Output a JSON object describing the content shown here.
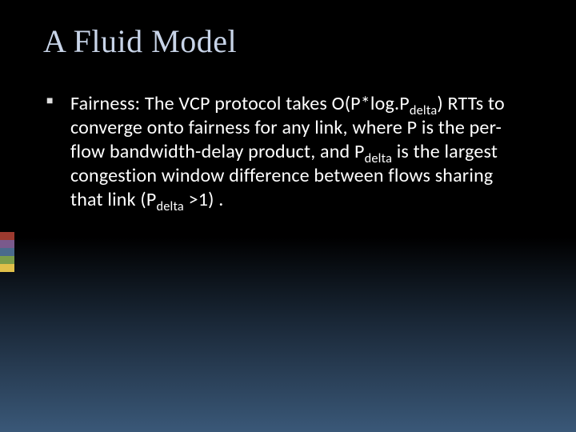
{
  "title": "A Fluid Model",
  "bullet": {
    "segments": [
      {
        "t": "Fairness: The VCP protocol takes O(P*log.P"
      },
      {
        "t": "delta",
        "sub": true
      },
      {
        "t": ") RTTs to converge onto fairness for any link, where P is the per-flow bandwidth-delay product, and P"
      },
      {
        "t": "delta",
        "sub": true
      },
      {
        "t": " is the largest congestion window difference between flows sharing that link (P"
      },
      {
        "t": "delta",
        "sub": true
      },
      {
        "t": " >1) ."
      }
    ]
  },
  "accent_colors": [
    "bar-red",
    "bar-purple",
    "bar-blue",
    "bar-green",
    "bar-yellow"
  ]
}
